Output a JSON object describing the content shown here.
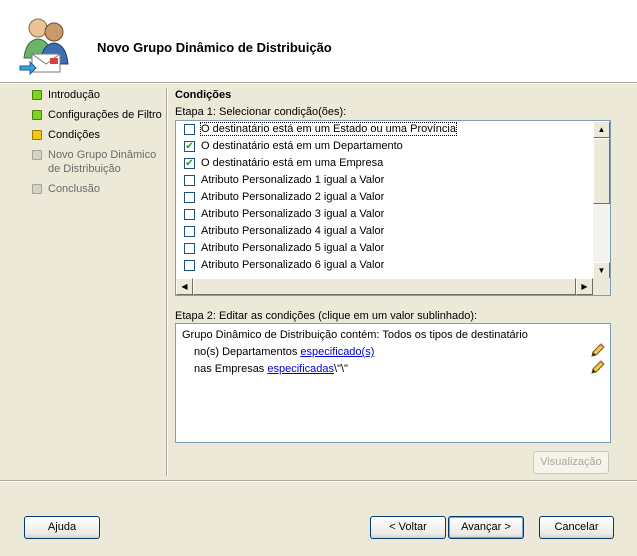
{
  "header": {
    "title": "Novo Grupo Dinâmico de Distribuição",
    "icon": "group-users-icon"
  },
  "steps": [
    {
      "label": "Introdução",
      "state": "done"
    },
    {
      "label": "Configurações de Filtro",
      "state": "done"
    },
    {
      "label": "Condições",
      "state": "current"
    },
    {
      "label": "Novo Grupo Dinâmico de Distribuição",
      "state": "pending"
    },
    {
      "label": "Conclusão",
      "state": "pending"
    }
  ],
  "main": {
    "section_title": "Condições",
    "step1_label": "Etapa 1: Selecionar condição(ões):",
    "conditions": [
      {
        "label": "O destinatário está em um Estado ou uma Província",
        "checked": false
      },
      {
        "label": "O destinatário está em um Departamento",
        "checked": true
      },
      {
        "label": "O destinatário está em uma Empresa",
        "checked": true
      },
      {
        "label": "Atributo Personalizado 1 igual a Valor",
        "checked": false
      },
      {
        "label": "Atributo Personalizado 2 igual a Valor",
        "checked": false
      },
      {
        "label": "Atributo Personalizado 3 igual a Valor",
        "checked": false
      },
      {
        "label": "Atributo Personalizado 4 igual a Valor",
        "checked": false
      },
      {
        "label": "Atributo Personalizado 5 igual a Valor",
        "checked": false
      },
      {
        "label": "Atributo Personalizado 6 igual a Valor",
        "checked": false
      }
    ],
    "step2_label": "Etapa 2: Editar as condições (clique em um valor sublinhado):",
    "edit": {
      "line1": "Grupo Dinâmico de Distribuição contém: Todos os tipos de destinatário",
      "line2_prefix": "no(s) Departamentos ",
      "line2_link": "especificado(s)",
      "line3_prefix": "nas Empresas ",
      "line3_link": "especificadas",
      "line3_suffix": "\\\"\\\""
    },
    "preview_button": "Visualização"
  },
  "footer": {
    "help": "Ajuda",
    "back": "< Voltar",
    "next": "Avançar >",
    "cancel": "Cancelar"
  },
  "colors": {
    "step_done": "#7ED321",
    "step_current": "#F5C518",
    "link": "#0000CC",
    "window": "#ECE9D8"
  }
}
